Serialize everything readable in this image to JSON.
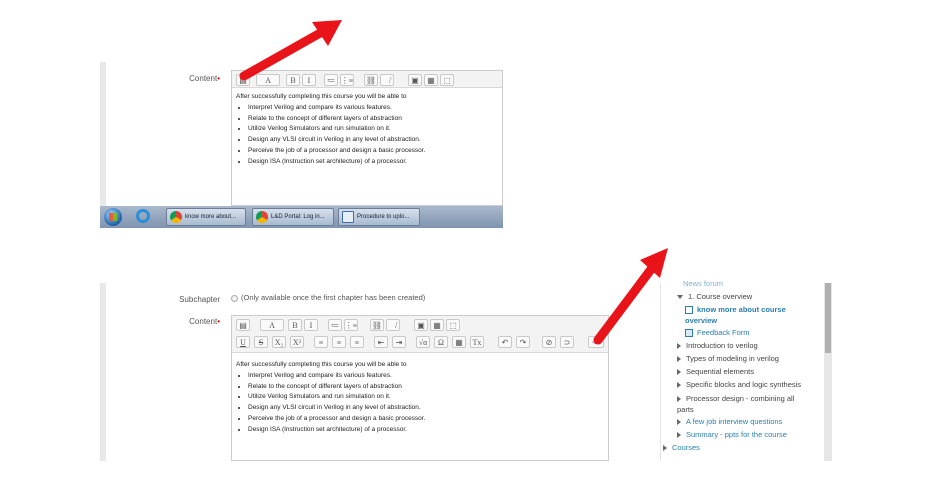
{
  "top": {
    "content_label": "Content",
    "required_mark": "•",
    "toolbar": [
      "▤",
      "A",
      "B",
      "I",
      "≔",
      "⋮≡",
      "⛓",
      "⛓̸",
      "▣",
      "▦",
      "⬚"
    ],
    "text": {
      "intro": "After successfully completing this course you will be able to",
      "bullets": [
        "Interpret Verilog and compare its various features.",
        "Relate to the concept of different layers of abstraction",
        "Utilize Verilog Simulators and run simulation on it.",
        "Design any VLSI circuit in Verilog in any level of abstraction.",
        "Perceive the job of a processor and design a basic processor.",
        "Design ISA (Instruction set architecture) of a processor."
      ]
    },
    "taskbar": {
      "buttons": [
        {
          "label": "know more about...",
          "icon": "chrome-icon"
        },
        {
          "label": "L&D Portal: Log in...",
          "icon": "chrome-icon"
        },
        {
          "label": "Procedure to uplo...",
          "icon": "document-icon"
        }
      ]
    }
  },
  "bottom": {
    "subchapter_label": "Subchapter",
    "subchapter_note": "(Only available once the first chapter has been created)",
    "content_label": "Content",
    "required_mark": "•",
    "toolbar_row1": [
      "▤",
      "A",
      "B",
      "I",
      "≔",
      "⋮≡",
      "⛓",
      "⛓̸",
      "▣",
      "▦",
      "⬚"
    ],
    "toolbar_row2": [
      "U",
      "S",
      "X₂",
      "X²",
      "≡",
      "≡",
      "≡",
      "⇤",
      "⇥",
      "√α",
      "Ω",
      "▦",
      "Tx",
      "↶",
      "↷",
      "⊘",
      "⊃",
      "<>"
    ],
    "text": {
      "intro": "After successfully completing this course you will be able to",
      "bullets": [
        "Interpret Verilog and compare its various features.",
        "Relate to the concept of different layers of abstraction",
        "Utilize Verilog Simulators and run simulation on it.",
        "Design any VLSI circuit in Verilog in any level of abstraction.",
        "Perceive the job of a processor and design a basic processor.",
        "Design ISA (Instruction set architecture) of a processor."
      ]
    }
  },
  "nav": {
    "top_cut": "News forum",
    "section": "1. Course overview",
    "current": "know more about course overview",
    "feedback": "Feedback Form",
    "items": [
      "Introduction to verilog",
      "Types of modeling in verilog",
      "Sequential elements",
      "Specific blocks and logic synthesis",
      "Processor design - combining all parts"
    ],
    "links": [
      "A few job interview questions",
      "Summary - ppts for the course"
    ],
    "courses": "Courses"
  },
  "colors": {
    "arrow": "#e8141a",
    "link": "#2a7fb0"
  }
}
